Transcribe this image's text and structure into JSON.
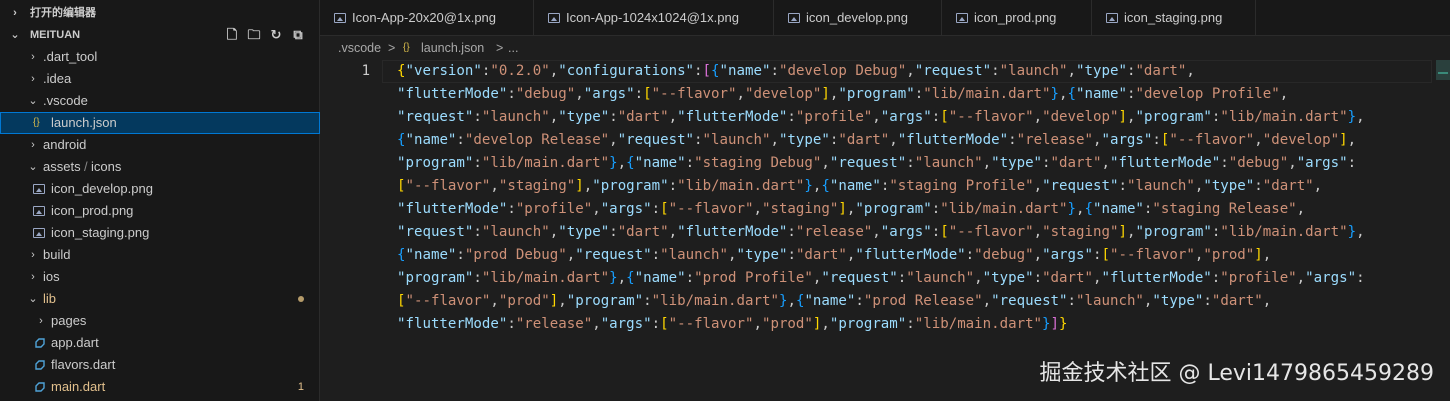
{
  "explorer": {
    "open_editors_label": "打开的编辑器",
    "project_label": "MEITUAN",
    "tree": [
      {
        "label": ".dart_tool"
      },
      {
        "label": ".idea"
      },
      {
        "label": ".vscode"
      },
      {
        "label": "launch.json",
        "icon": "{}"
      },
      {
        "label": "android"
      },
      {
        "label": "assets",
        "sep": "/",
        "label2": "icons"
      },
      {
        "label": "icon_develop.png"
      },
      {
        "label": "icon_prod.png"
      },
      {
        "label": "icon_staging.png"
      },
      {
        "label": "build"
      },
      {
        "label": "ios"
      },
      {
        "label": "lib"
      },
      {
        "label": "pages"
      },
      {
        "label": "app.dart"
      },
      {
        "label": "flavors.dart"
      },
      {
        "label": "main.dart",
        "badge": "1"
      }
    ]
  },
  "tabs": [
    {
      "label": "Icon-App-20x20@1x.png"
    },
    {
      "label": "Icon-App-1024x1024@1x.png"
    },
    {
      "label": "icon_develop.png"
    },
    {
      "label": "icon_prod.png"
    },
    {
      "label": "icon_staging.png"
    }
  ],
  "breadcrumb": {
    "folder": ".vscode",
    "sep": ">",
    "icon": "{}",
    "file": "launch.json",
    "more": "..."
  },
  "editor": {
    "line_number": "1",
    "lines": [
      "{\"version\":\"0.2.0\",\"configurations\":[{\"name\":\"develop Debug\",\"request\":\"launch\",\"type\":\"dart\",",
      "\"flutterMode\":\"debug\",\"args\":[\"--flavor\",\"develop\"],\"program\":\"lib/main.dart\"},{\"name\":\"develop Profile\",",
      "\"request\":\"launch\",\"type\":\"dart\",\"flutterMode\":\"profile\",\"args\":[\"--flavor\",\"develop\"],\"program\":\"lib/main.dart\"},",
      "{\"name\":\"develop Release\",\"request\":\"launch\",\"type\":\"dart\",\"flutterMode\":\"release\",\"args\":[\"--flavor\",\"develop\"],",
      "\"program\":\"lib/main.dart\"},{\"name\":\"staging Debug\",\"request\":\"launch\",\"type\":\"dart\",\"flutterMode\":\"debug\",\"args\":",
      "[\"--flavor\",\"staging\"],\"program\":\"lib/main.dart\"},{\"name\":\"staging Profile\",\"request\":\"launch\",\"type\":\"dart\",",
      "\"flutterMode\":\"profile\",\"args\":[\"--flavor\",\"staging\"],\"program\":\"lib/main.dart\"},{\"name\":\"staging Release\",",
      "\"request\":\"launch\",\"type\":\"dart\",\"flutterMode\":\"release\",\"args\":[\"--flavor\",\"staging\"],\"program\":\"lib/main.dart\"},",
      "{\"name\":\"prod Debug\",\"request\":\"launch\",\"type\":\"dart\",\"flutterMode\":\"debug\",\"args\":[\"--flavor\",\"prod\"],",
      "\"program\":\"lib/main.dart\"},{\"name\":\"prod Profile\",\"request\":\"launch\",\"type\":\"dart\",\"flutterMode\":\"profile\",\"args\":",
      "[\"--flavor\",\"prod\"],\"program\":\"lib/main.dart\"},{\"name\":\"prod Release\",\"request\":\"launch\",\"type\":\"dart\",",
      "\"flutterMode\":\"release\",\"args\":[\"--flavor\",\"prod\"],\"program\":\"lib/main.dart\"}]}"
    ]
  },
  "watermark": "掘金技术社区 @ Levi1479865459289",
  "colors": {
    "key": "#9cdcfe",
    "string": "#ce9178",
    "bracket1": "#ffd700",
    "bracket2": "#da70d6",
    "bracket3": "#179fff",
    "modified": "#e2c08d",
    "selection": "#04395e"
  }
}
